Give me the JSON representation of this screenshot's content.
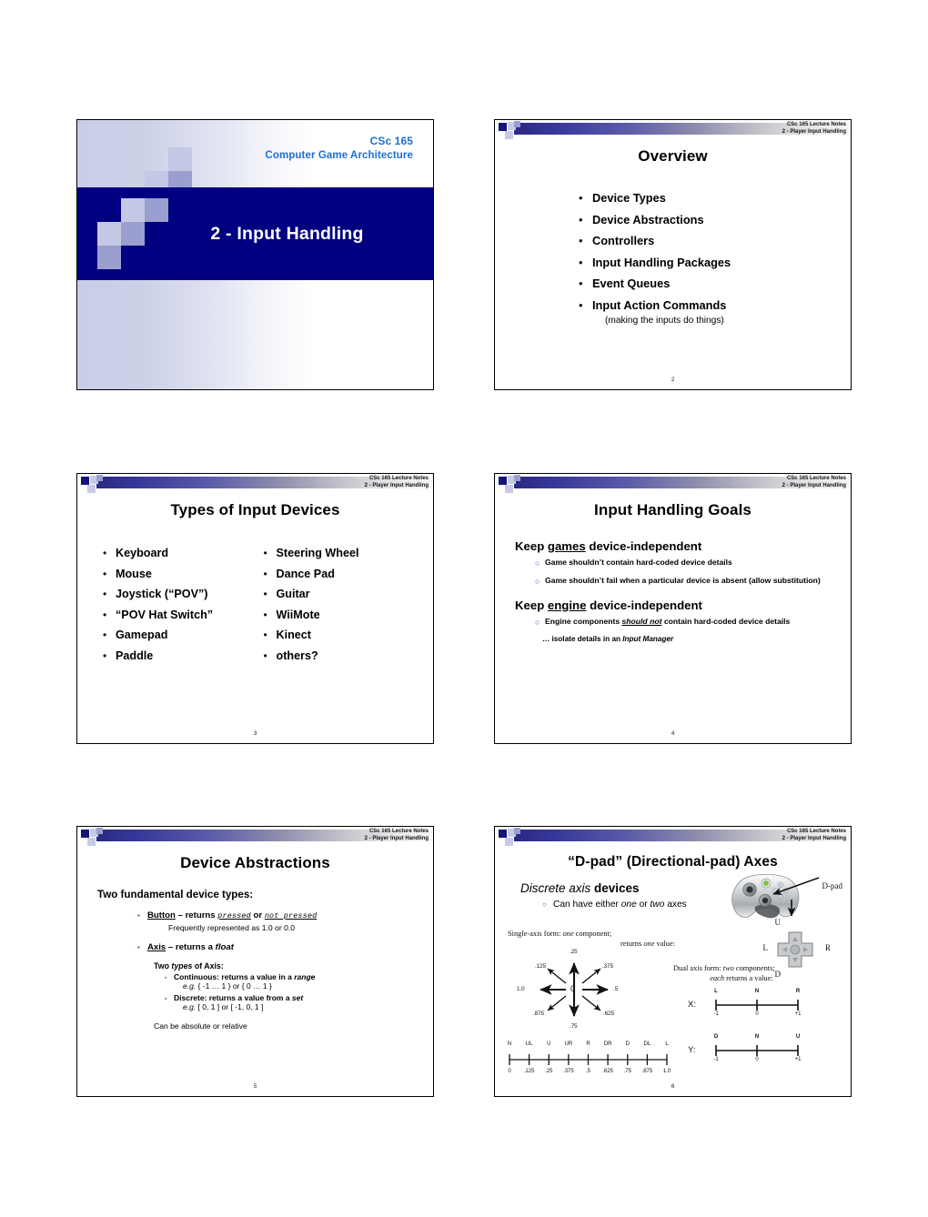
{
  "header": {
    "line1": "CSc 165 Lecture Notes",
    "line2": "2 - Player Input Handling"
  },
  "slides": [
    {
      "id": "title-slide",
      "course": "CSc 165",
      "subject": "Computer Game Architecture",
      "title": "2 - Input Handling"
    },
    {
      "id": "overview",
      "title": "Overview",
      "page": "2",
      "bullets": [
        "Device Types",
        "Device Abstractions",
        "Controllers",
        "Input Handling Packages",
        "Event Queues",
        "Input Action Commands"
      ],
      "subnote": "(making the inputs do things)"
    },
    {
      "id": "types-of-input-devices",
      "title": "Types of Input Devices",
      "page": "3",
      "left_items": [
        "Keyboard",
        "Mouse",
        "Joystick (“POV”)",
        "“POV Hat Switch”",
        "Gamepad",
        "Paddle"
      ],
      "right_items": [
        "Steering Wheel",
        "Dance Pad",
        "Guitar",
        "WiiMote",
        "Kinect",
        "others?"
      ]
    },
    {
      "id": "input-handling-goals",
      "title": "Input Handling Goals",
      "page": "4",
      "heading1_pre": "Keep ",
      "heading1_em": "games",
      "heading1_post": " device-independent",
      "sub1a": "Game shouldn’t contain hard-coded device details",
      "sub1b": "Game shouldn’t fail when a particular device is absent (allow substitution)",
      "heading2_pre": "Keep ",
      "heading2_em": "engine",
      "heading2_post": " device-independent",
      "sub2a_pre": "Engine components  ",
      "sub2a_em": "should not",
      "sub2a_post": "  contain hard-coded device details",
      "note": "… isolate details in an ",
      "note_em": "Input Manager"
    },
    {
      "id": "device-abstractions",
      "title": "Device Abstractions",
      "page": "5",
      "heading": "Two fundamental device types:",
      "button_label": "Button",
      "button_text": " – returns ",
      "button_val1": "pressed",
      "button_or": " or ",
      "button_val2": "not pressed",
      "button_note": "Frequently represented as 1.0 or 0.0",
      "axis_label": "Axis",
      "axis_text_pre": " – returns a ",
      "axis_text_em": "float",
      "axis_types_pre": "Two ",
      "axis_types_em": "types",
      "axis_types_post": " of Axis:",
      "cont_pre": "Continuous: returns a value in a ",
      "cont_em": "range",
      "cont_eg_em": "e.g.",
      "cont_eg": " { -1 … 1 }   or   { 0 … 1 }",
      "disc_pre": "Discrete:  returns a value from a ",
      "disc_em": "set",
      "disc_eg_em": "e.g.",
      "disc_eg": " [ 0, 1 ]   or   [ -1,  0,  1 ]",
      "last": "Can be absolute or relative"
    },
    {
      "id": "dpad-axes",
      "title": "“D-pad” (Directional-pad) Axes",
      "page": "6",
      "heading_em": "Discrete axis",
      "heading_post": " devices",
      "sub_pre": "Can have either ",
      "sub_em1": "one",
      "sub_mid": " or ",
      "sub_em2": "two",
      "sub_post": " axes",
      "single_line1_pre": "Single-axis form: ",
      "single_line1_em": "one",
      "single_line1_post": " component;",
      "single_line2_pre": "returns ",
      "single_line2_em": "one",
      "single_line2_post": " value:",
      "dual_line1_pre": "Dual axis form: ",
      "dual_line1_em": "two",
      "dual_line1_post": " components;",
      "dual_line2_em": "each",
      "dual_line2_post": " returns a value:",
      "dpad_caption": "D-pad",
      "dpad_up": "U",
      "dpad_down": "D",
      "dpad_left": "L",
      "dpad_right": "R",
      "center_value": "0"
    }
  ],
  "chart_data": [
    {
      "type": "scatter",
      "id": "compass-dial",
      "title": "Single-axis D-pad directional values",
      "notes": "Eight arrows radiating from a center labeled 0; each arrow annotated with its returned float value.",
      "center_label": "0",
      "directions": [
        {
          "name": "N",
          "angle_deg": 90,
          "value": ".25"
        },
        {
          "name": "NE",
          "angle_deg": 45,
          "value": ".375"
        },
        {
          "name": "E",
          "angle_deg": 0,
          "value": ".5"
        },
        {
          "name": "SE",
          "angle_deg": -45,
          "value": ".625"
        },
        {
          "name": "S",
          "angle_deg": -90,
          "value": ".75"
        },
        {
          "name": "SW",
          "angle_deg": -135,
          "value": ".875"
        },
        {
          "name": "W",
          "angle_deg": 180,
          "value": "1.0"
        },
        {
          "name": "NW",
          "angle_deg": 135,
          "value": ".125"
        }
      ]
    },
    {
      "type": "line",
      "id": "single-axis-numberline",
      "title": "Single-axis form number line",
      "xlabel": "",
      "ylabel": "",
      "xlim": [
        0,
        1.0
      ],
      "grid": false,
      "tick_top_labels": [
        "N",
        "UL",
        "U",
        "UR",
        "R",
        "DR",
        "D",
        "DL",
        "L"
      ],
      "tick_bottom_labels": [
        "0",
        ".125",
        ".25",
        ".375",
        ".5",
        ".625",
        ".75",
        ".875",
        "1.0"
      ],
      "tick_values": [
        0,
        0.125,
        0.25,
        0.375,
        0.5,
        0.625,
        0.75,
        0.875,
        1.0
      ]
    },
    {
      "type": "line",
      "id": "dual-axis-x",
      "title": "X:",
      "xlim": [
        -1,
        1
      ],
      "grid": false,
      "tick_top_labels": [
        "L",
        "N",
        "R"
      ],
      "tick_bottom_labels": [
        "-1",
        "0",
        "+1"
      ],
      "tick_values": [
        -1,
        0,
        1
      ]
    },
    {
      "type": "line",
      "id": "dual-axis-y",
      "title": "Y:",
      "xlim": [
        -1,
        1
      ],
      "grid": false,
      "tick_top_labels": [
        "D",
        "N",
        "U"
      ],
      "tick_bottom_labels": [
        "-1",
        "0",
        "+1"
      ],
      "tick_values": [
        -1,
        0,
        1
      ]
    }
  ],
  "colors": {
    "brand_dark": "#000080",
    "brand_mid": "#9a9fd0",
    "brand_light": "#c5c8e4",
    "title_text": "#1f6fd0",
    "bullet_o": "#3b3bbb"
  }
}
